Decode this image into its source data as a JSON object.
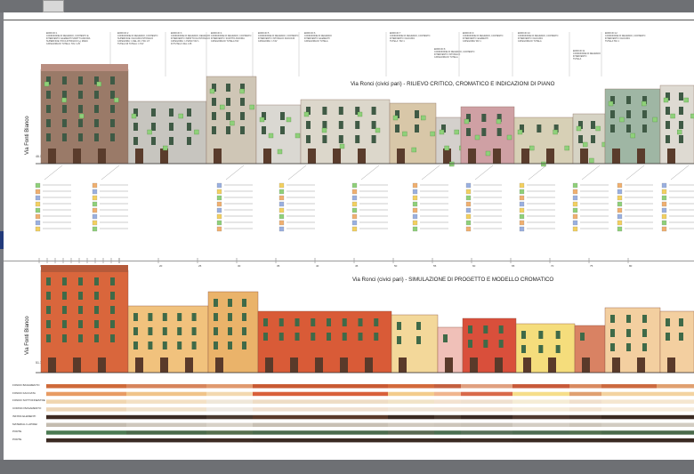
{
  "upper": {
    "title": "Via Ronci (civici pari) -  RILIEVO CRITICO, CROMATICO E INDICAZIONI DI PIANO",
    "side_label": "Via Fonti Bianco",
    "elevation": "46.10"
  },
  "lower": {
    "title": "Via Ronci (civici pari) - SIMULAZIONE DI PROGETTO E MODELLO CROMATICO",
    "side_label": "Via Fonti Bianco",
    "elevation": "51.70"
  },
  "header_notes": [
    {
      "lines": [
        "EDIFICIO 1",
        "CONDIZIONE DI DEGRADO, CONTESTO E",
        "INTERVENTO: ELEMENTI SCRITTI ANCORA",
        "SUPERFICIE: POCA INTONACO (+) MANU",
        "CATEGORIA DI TUTELA: TAV. 1:25"
      ]
    },
    {
      "lines": [
        "EDIFICIO 2",
        "CONDIZIONE DI DEGRADO, CONTESTO",
        "SUPERFICIE: FACCIATA INTONACO",
        "CATEGORIA: 1 DEL 26 1 TAV 1 P",
        "TUTELA DI TUTELA: 1 TAV"
      ]
    },
    {
      "lines": [
        "EDIFICIO 3",
        "CONDIZIONE DI DEGRADO, DEGRADO",
        "INTERVENTO: IMPATTO DA INTONACO",
        "CATEGORIA: 1 PIANO TAV 1",
        "DI TUTELA: DEL 1:25"
      ]
    },
    {
      "lines": [
        "EDIFICIO 4",
        "CONDIZIONE DI DEGRADO, CONTESTO",
        "INTERVENTO: SCRITTO ANCORA",
        "CATEGORIA DI TUTELA TAV"
      ]
    },
    {
      "lines": [
        "EDIFICIO 5",
        "CONDIZIONE DI DEGRADO, CONTESTO",
        "INTERVENTO: INTONACO FACCIATA",
        "CATEGORIA: 1 TAV"
      ]
    },
    {
      "lines": [
        "EDIFICIO 6",
        "CONDIZIONE DI DEGRADO",
        "INTERVENTO: ELEMENTI",
        "CATEGORIA DI TUTELA"
      ]
    },
    {
      "lines": [
        "EDIFICIO 7",
        "CONDIZIONE DI DEGRADO, CONTESTO",
        "INTERVENTO: FACCIATA",
        "TUTELA: TAV 1"
      ]
    },
    {
      "lines": [
        "EDIFICIO 8",
        "CONDIZIONE DI DEGRADO, CONTESTO",
        "INTERVENTO: INTONACO",
        "CATEGORIA DI TUTELA"
      ]
    },
    {
      "lines": [
        "EDIFICIO 9",
        "CONDIZIONE DI DEGRADO, CONTESTO",
        "INTERVENTO: ELEMENTI",
        "CATEGORIA TAV 1"
      ]
    },
    {
      "lines": [
        "EDIFICIO 10",
        "CONDIZIONE DI DEGRADO, CONTESTO",
        "INTERVENTO: FACCIATA",
        "CATEGORIA DI TUTELA"
      ]
    },
    {
      "lines": [
        "EDIFICIO 11",
        "CONDIZIONE DI DEGRADO",
        "INTERVENTO",
        "TUTELA"
      ]
    },
    {
      "lines": [
        "EDIFICIO 12",
        "CONDIZIONE DI DEGRADO, CONTESTO",
        "INTERVENTO: FACCIATA",
        "TUTELA TAV 1"
      ]
    }
  ],
  "color_rows": [
    {
      "label": "FONDO BASAMENTO",
      "colors": [
        "#cf6a3a",
        "#d7855c",
        "#e09a6f",
        "#c95a33",
        "#d36a3c",
        "#c46040",
        "#e0a080",
        "#c85a3a",
        "#d98a60",
        "#cc6a40",
        "#e0a070"
      ]
    },
    {
      "label": "FONDO FACCIATA",
      "colors": [
        "#e89b63",
        "#f0c48a",
        "#f3d9b0",
        "#d9603a",
        "#f3cc8c",
        "#f0b58e",
        "#d96a4a",
        "#f6de8a",
        "#e0a070",
        "#f3d3a0",
        "#f3d3a0"
      ]
    },
    {
      "label": "FONDO SOTTOFINESTRE",
      "colors": [
        "#f0d6b0",
        "#f3e0c4",
        "#efe7d9",
        "#eedcc5",
        "#f1e3c8",
        "#f3e2d0",
        "#efe0cf",
        "#f5ecd5",
        "#f0dfcc",
        "#f5e6cf",
        "#f5e6cf"
      ]
    },
    {
      "label": "CORNICI BASAMENTO",
      "colors": [
        "#ecd6b8",
        "#f0e2cc",
        "#eeeae4",
        "#f0e0d0",
        "#efe5d8",
        "#f2e4d6",
        "#f3e3d3",
        "#f6ecda",
        "#f3e4d2",
        "#f7ecdc",
        "#f7ecdc"
      ]
    },
    {
      "label": "INFISSI ELEMENTI",
      "colors": [
        "#3e2a22",
        "#3a2b24",
        "#4a3a30",
        "#5a3a2a",
        "#3a2a22",
        "#4a3a30",
        "#3a2a24",
        "#503a30",
        "#46342c",
        "#3a2a22",
        "#3a2a22"
      ]
    },
    {
      "label": "MATERIALI LAPIDEI",
      "colors": [
        "#c4bcb0",
        "#cfc8bd",
        "#d8d2c8",
        "#c8c0b4",
        "#d0c9be",
        "#cdc6bb",
        "#c9c2b7",
        "#d4cec4",
        "#ccc5ba",
        "#d2ccc2",
        "#d2ccc2"
      ]
    },
    {
      "label": "PORTE",
      "colors": [
        "#4b7a52",
        "#4a6a4a",
        "#56704e",
        "#4b6b4d",
        "#5a6a52",
        "#4a6e50",
        "#567058",
        "#4e6c52",
        "#52704e",
        "#4a6a4a",
        "#4a6a4a"
      ]
    },
    {
      "label": "PORTE",
      "colors": [
        "#3b2a22",
        "#3a2b25",
        "#3e2c24",
        "#3a2a22",
        "#3b2b23",
        "#3a2a22",
        "#3c2c24",
        "#3a2a22",
        "#3b2b23",
        "#3a2a22",
        "#3a2a22"
      ]
    }
  ],
  "ruler_labels": [
    "0",
    "1",
    "2",
    "3",
    "4",
    "5",
    "6",
    "7",
    "8",
    "9",
    "10",
    "15",
    "20",
    "25",
    "30",
    "35",
    "40",
    "45",
    "50",
    "55",
    "60",
    "65",
    "70",
    "75",
    "80"
  ],
  "colors": {
    "background": "#7b7d82",
    "sheet": "#ffffff",
    "accent_blue": "#223a7a"
  }
}
